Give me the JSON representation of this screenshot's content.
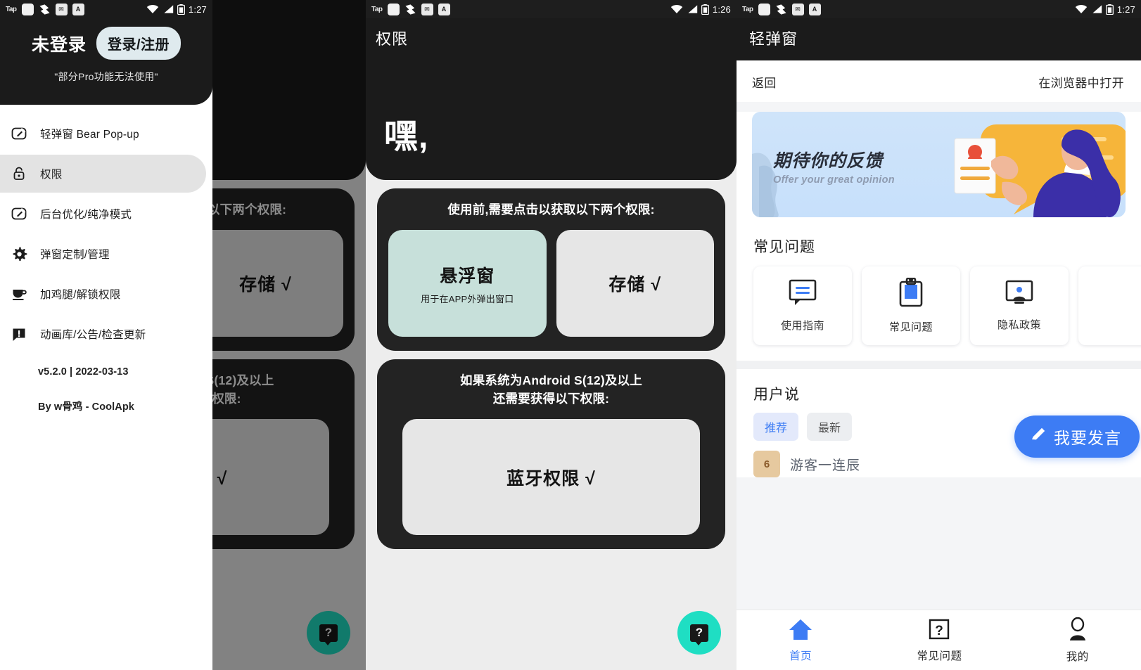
{
  "statusbar": {
    "tap_label": "Tap",
    "time_left": "1:27",
    "time_mid": "1:26",
    "time_right": "1:27",
    "icons": [
      "notification-square-icon",
      "sync-icon",
      "mail-icon",
      "app-a-icon"
    ],
    "right_icons": [
      "wifi-icon",
      "signal-icon",
      "battery-icon"
    ]
  },
  "drawer": {
    "account_status": "未登录",
    "login_button": "登录/注册",
    "account_note": "\"部分Pro功能无法使用\"",
    "items": [
      {
        "label": "轻弹窗 Bear Pop-up",
        "icon": "pop-up-window-icon",
        "active": false
      },
      {
        "label": "权限",
        "icon": "lock-icon",
        "active": true
      },
      {
        "label": "后台优化/纯净模式",
        "icon": "pop-up-window-icon",
        "active": false
      },
      {
        "label": "弹窗定制/管理",
        "icon": "gear-icon",
        "active": false
      },
      {
        "label": "加鸡腿/解锁权限",
        "icon": "coffee-icon",
        "active": false
      },
      {
        "label": "动画库/公告/检查更新",
        "icon": "announcement-icon",
        "active": false
      }
    ],
    "version": "v5.2.0 | 2022-03-13",
    "author": "By w骨鸡 - CoolApk"
  },
  "permissions": {
    "appbar_title": "权限",
    "hero": "嘿,",
    "card1": {
      "title": "使用前,需要点击以获取以下两个权限:",
      "buttons": [
        {
          "label": "悬浮窗",
          "sub": "用于在APP外弹出窗口",
          "granted": false,
          "highlight": true
        },
        {
          "label": "存储 √",
          "sub": "",
          "granted": true,
          "highlight": false
        }
      ]
    },
    "card2": {
      "title_line1": "如果系统为Android S(12)及以上",
      "title_line2": "还需要获得以下权限:",
      "button": {
        "label": "蓝牙权限 √",
        "granted": true
      }
    },
    "fab": "help-fab-icon"
  },
  "webview": {
    "appbar_title": "轻弹窗",
    "nav_back": "返回",
    "nav_open_browser": "在浏览器中打开",
    "banner": {
      "title": "期待你的反馈",
      "subtitle": "Offer your great opinion",
      "illustration": "feedback-illustration"
    },
    "faq_section_title": "常见问题",
    "faq_cards": [
      {
        "label": "使用指南",
        "icon": "chat-guide-icon"
      },
      {
        "label": "常见问题",
        "icon": "clipboard-icon"
      },
      {
        "label": "隐私政策",
        "icon": "monitor-user-icon"
      },
      {
        "label": "",
        "icon": "partial-card-icon"
      }
    ],
    "users_section_title": "用户说",
    "chips": [
      {
        "label": "推荐",
        "active": true
      },
      {
        "label": "最新",
        "active": false
      }
    ],
    "user_rows": [
      {
        "avatar_text": "6",
        "name": "游客一连辰"
      }
    ],
    "speak_button": "我要发言",
    "tabs": [
      {
        "label": "首页",
        "icon": "home-icon",
        "active": true
      },
      {
        "label": "常见问题",
        "icon": "question-box-icon",
        "active": false
      },
      {
        "label": "我的",
        "icon": "person-icon",
        "active": false
      }
    ]
  },
  "colors": {
    "accent_blue": "#3d7cf4",
    "teal_fab": "#1fdec3",
    "permission_highlight": "#c7e0da",
    "dark_surface": "#1b1b1b"
  }
}
